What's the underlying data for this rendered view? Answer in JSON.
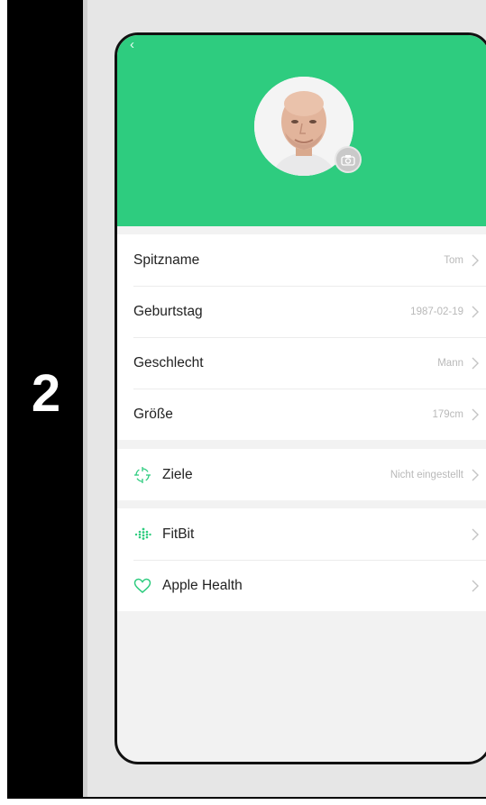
{
  "step": {
    "number": "2"
  },
  "colors": {
    "header_green": "#2ecc7f",
    "icon_green": "#2ecc7f",
    "value_gray": "#b9b9b9"
  },
  "header": {
    "back_icon": "chevron-left-icon",
    "avatar_icon": "avatar",
    "camera_icon": "camera-icon"
  },
  "profile": {
    "rows": [
      {
        "label": "Spitzname",
        "value": "Tom"
      },
      {
        "label": "Geburtstag",
        "value": "1987-02-19"
      },
      {
        "label": "Geschlecht",
        "value": "Mann"
      },
      {
        "label": "Größe",
        "value": "179cm"
      }
    ]
  },
  "goals": {
    "label": "Ziele",
    "value": "Nicht eingestellt",
    "icon": "target-icon"
  },
  "integrations": [
    {
      "label": "FitBit",
      "icon": "fitbit-icon"
    },
    {
      "label": "Apple Health",
      "icon": "heart-icon"
    }
  ]
}
